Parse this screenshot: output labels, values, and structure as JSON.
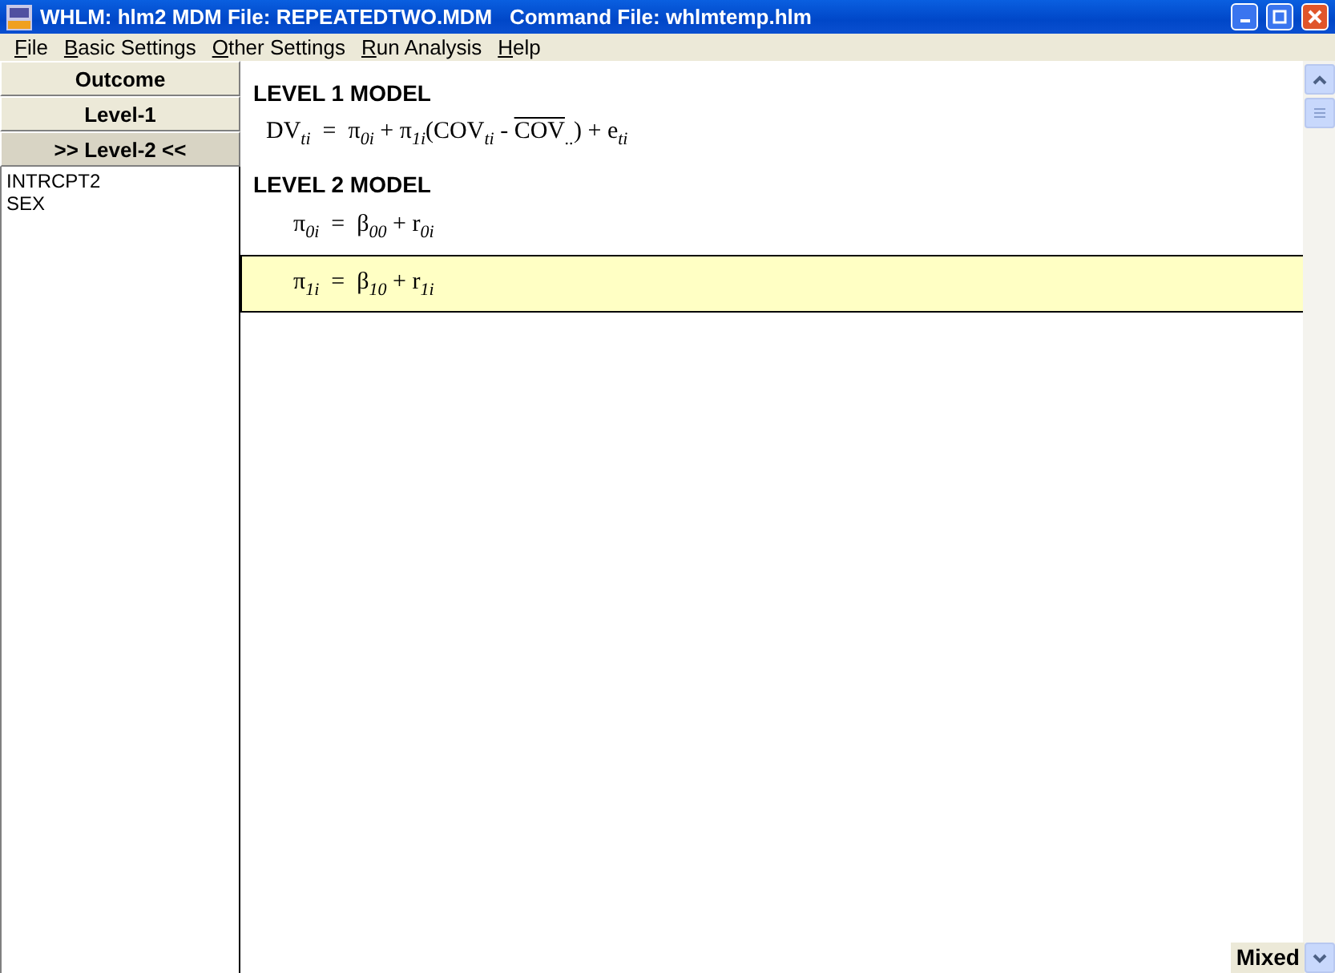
{
  "window": {
    "title": "WHLM: hlm2 MDM File: REPEATEDTWO.MDM   Command File: whlmtemp.hlm"
  },
  "menu": [
    {
      "accel": "F",
      "rest": "ile"
    },
    {
      "accel": "B",
      "rest": "asic Settings"
    },
    {
      "accel": "O",
      "rest": "ther Settings"
    },
    {
      "accel": "R",
      "rest": "un Analysis"
    },
    {
      "accel": "H",
      "rest": "elp"
    }
  ],
  "level_buttons": [
    {
      "label": "Outcome",
      "selected": false
    },
    {
      "label": "Level-1",
      "selected": false
    },
    {
      "label": ">> Level-2 <<",
      "selected": true
    }
  ],
  "variables": [
    "INTRCPT2",
    "SEX"
  ],
  "level1": {
    "heading": "LEVEL 1 MODEL",
    "equation": [
      {
        "text": "DV$_{ti}$  =  π$_{0i}$ + π$_{1i}$(COV$_{ti}$ - ",
        "overline": false
      },
      {
        "text": "COV",
        "overline": true
      },
      {
        "text": "$_{..}$) + e$_{ti}$",
        "overline": false
      }
    ]
  },
  "level2": {
    "heading": "LEVEL 2 MODEL",
    "equations": [
      {
        "text": "π$_{0i}$  =  β$_{00}$ + r$_{0i}$",
        "selected": false
      },
      {
        "text": "π$_{1i}$  =  β$_{10}$ + r$_{1i}$",
        "selected": true
      }
    ]
  },
  "mode": {
    "value": "Mixed"
  }
}
